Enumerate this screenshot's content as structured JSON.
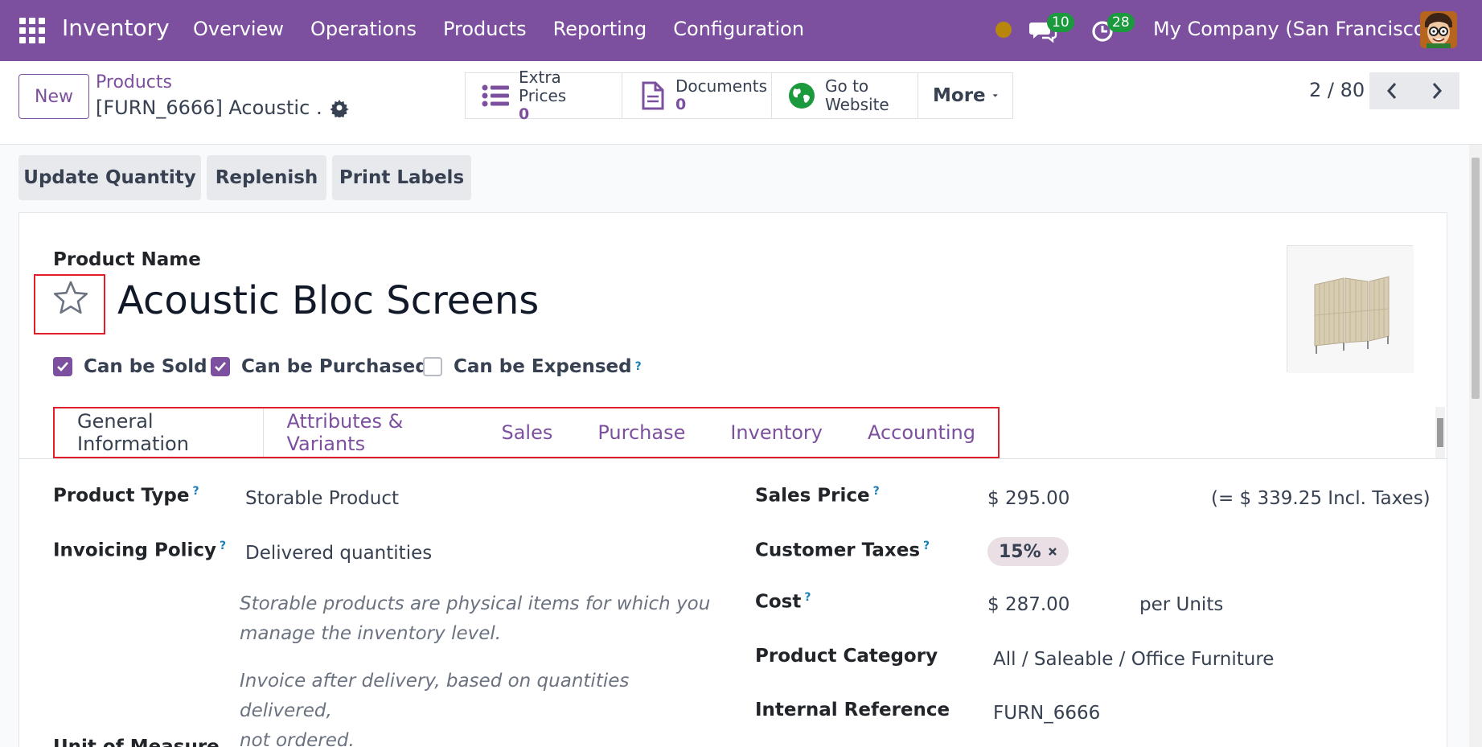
{
  "navbar": {
    "app_name": "Inventory",
    "menu": [
      "Overview",
      "Operations",
      "Products",
      "Reporting",
      "Configuration"
    ],
    "messages_count": "10",
    "activities_count": "28",
    "company": "My Company (San Francisco)",
    "colors": {
      "bar": "#7c509f",
      "badge": "#1a9a3c",
      "status_dot": "#b8860b"
    }
  },
  "control_panel": {
    "new_label": "New",
    "breadcrumb_parent": "Products",
    "breadcrumb_current": "[FURN_6666] Acoustic …",
    "smart_buttons": [
      {
        "icon": "list-icon",
        "label": "Extra Prices",
        "value": "0"
      },
      {
        "icon": "document-icon",
        "label": "Documents",
        "value": "0"
      },
      {
        "icon": "globe-icon",
        "label_line1": "Go to",
        "label_line2": "Website"
      }
    ],
    "more_label": "More",
    "pager": "2 / 80"
  },
  "actions": [
    "Update Quantity",
    "Replenish",
    "Print Labels"
  ],
  "form": {
    "product_name_label": "Product Name",
    "product_name": "Acoustic Bloc Screens",
    "checkboxes": [
      {
        "label": "Can be Sold",
        "checked": true
      },
      {
        "label": "Can be Purchased",
        "checked": true
      },
      {
        "label": "Can be Expensed",
        "checked": false,
        "help": "?"
      }
    ],
    "tabs": [
      "General Information",
      "Attributes & Variants",
      "Sales",
      "Purchase",
      "Inventory",
      "Accounting"
    ],
    "active_tab": "General Information",
    "left": {
      "product_type_label": "Product Type",
      "product_type": "Storable Product",
      "invoicing_policy_label": "Invoicing Policy",
      "invoicing_policy": "Delivered quantities",
      "help_type_line1": "Storable products are physical items for which you",
      "help_type_line2": "manage the inventory level.",
      "help_policy_line1": "Invoice after delivery, based on quantities delivered,",
      "help_policy_line2": "not ordered.",
      "partial_label": "Unit of Measure"
    },
    "right": {
      "sales_price_label": "Sales Price",
      "sales_price": "$ 295.00",
      "incl_taxes": "(= $ 339.25 Incl. Taxes)",
      "customer_taxes_label": "Customer Taxes",
      "tax_tag": "15%",
      "cost_label": "Cost",
      "cost": "$ 287.00",
      "cost_uom": "per Units",
      "category_label": "Product Category",
      "category": "All / Saleable / Office Furniture",
      "internal_ref_label": "Internal Reference",
      "internal_ref": "FURN_6666"
    },
    "help_mark": "?"
  }
}
